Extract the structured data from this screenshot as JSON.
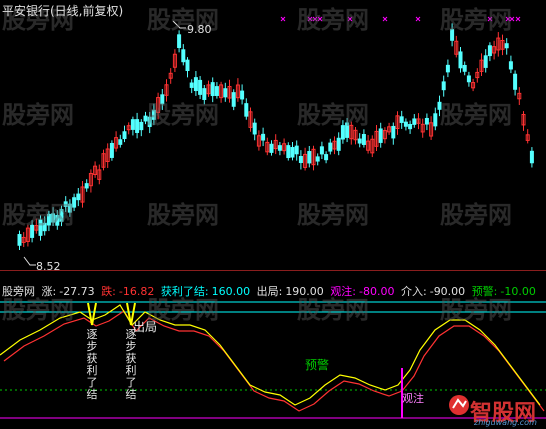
{
  "title": "平安银行(日线,前复权)",
  "price_high_label": "9.80",
  "price_low_label": "8.52",
  "indicator_bar": {
    "name": "股旁网",
    "zhang_label": "涨:",
    "zhang_value": "-27.73",
    "die_label": "跌:",
    "die_value": "-16.82",
    "huoli_label": "获利了结:",
    "huoli_value": "160.00",
    "chuju_label": "出局:",
    "chuju_value": "190.00",
    "guanzhu_label": "观注:",
    "guanzhu_value": "-80.00",
    "jieru_label": "介入:",
    "jieru_value": "-90.00",
    "yujing_label": "预警:",
    "yujing_value": "-10.00"
  },
  "annotations": {
    "zhubu_1": "逐步获利了结",
    "zhubu_2": "逐步获利了结",
    "chuju": "出局",
    "yujing": "预警",
    "guanzhu": "观注"
  },
  "watermark": "股旁网",
  "logo": {
    "text": "智股网",
    "sub": "zhiguwang.com"
  },
  "colors": {
    "background": "#000000",
    "candle_up": "#ff3232",
    "candle_down": "#54ffff",
    "line_white": "#ffffff",
    "line_red": "#ff3232",
    "line_yellow": "#ffff00",
    "level_cyan": "#00ffff",
    "level_green": "#00cc00",
    "level_magenta": "#ff00ff"
  }
}
